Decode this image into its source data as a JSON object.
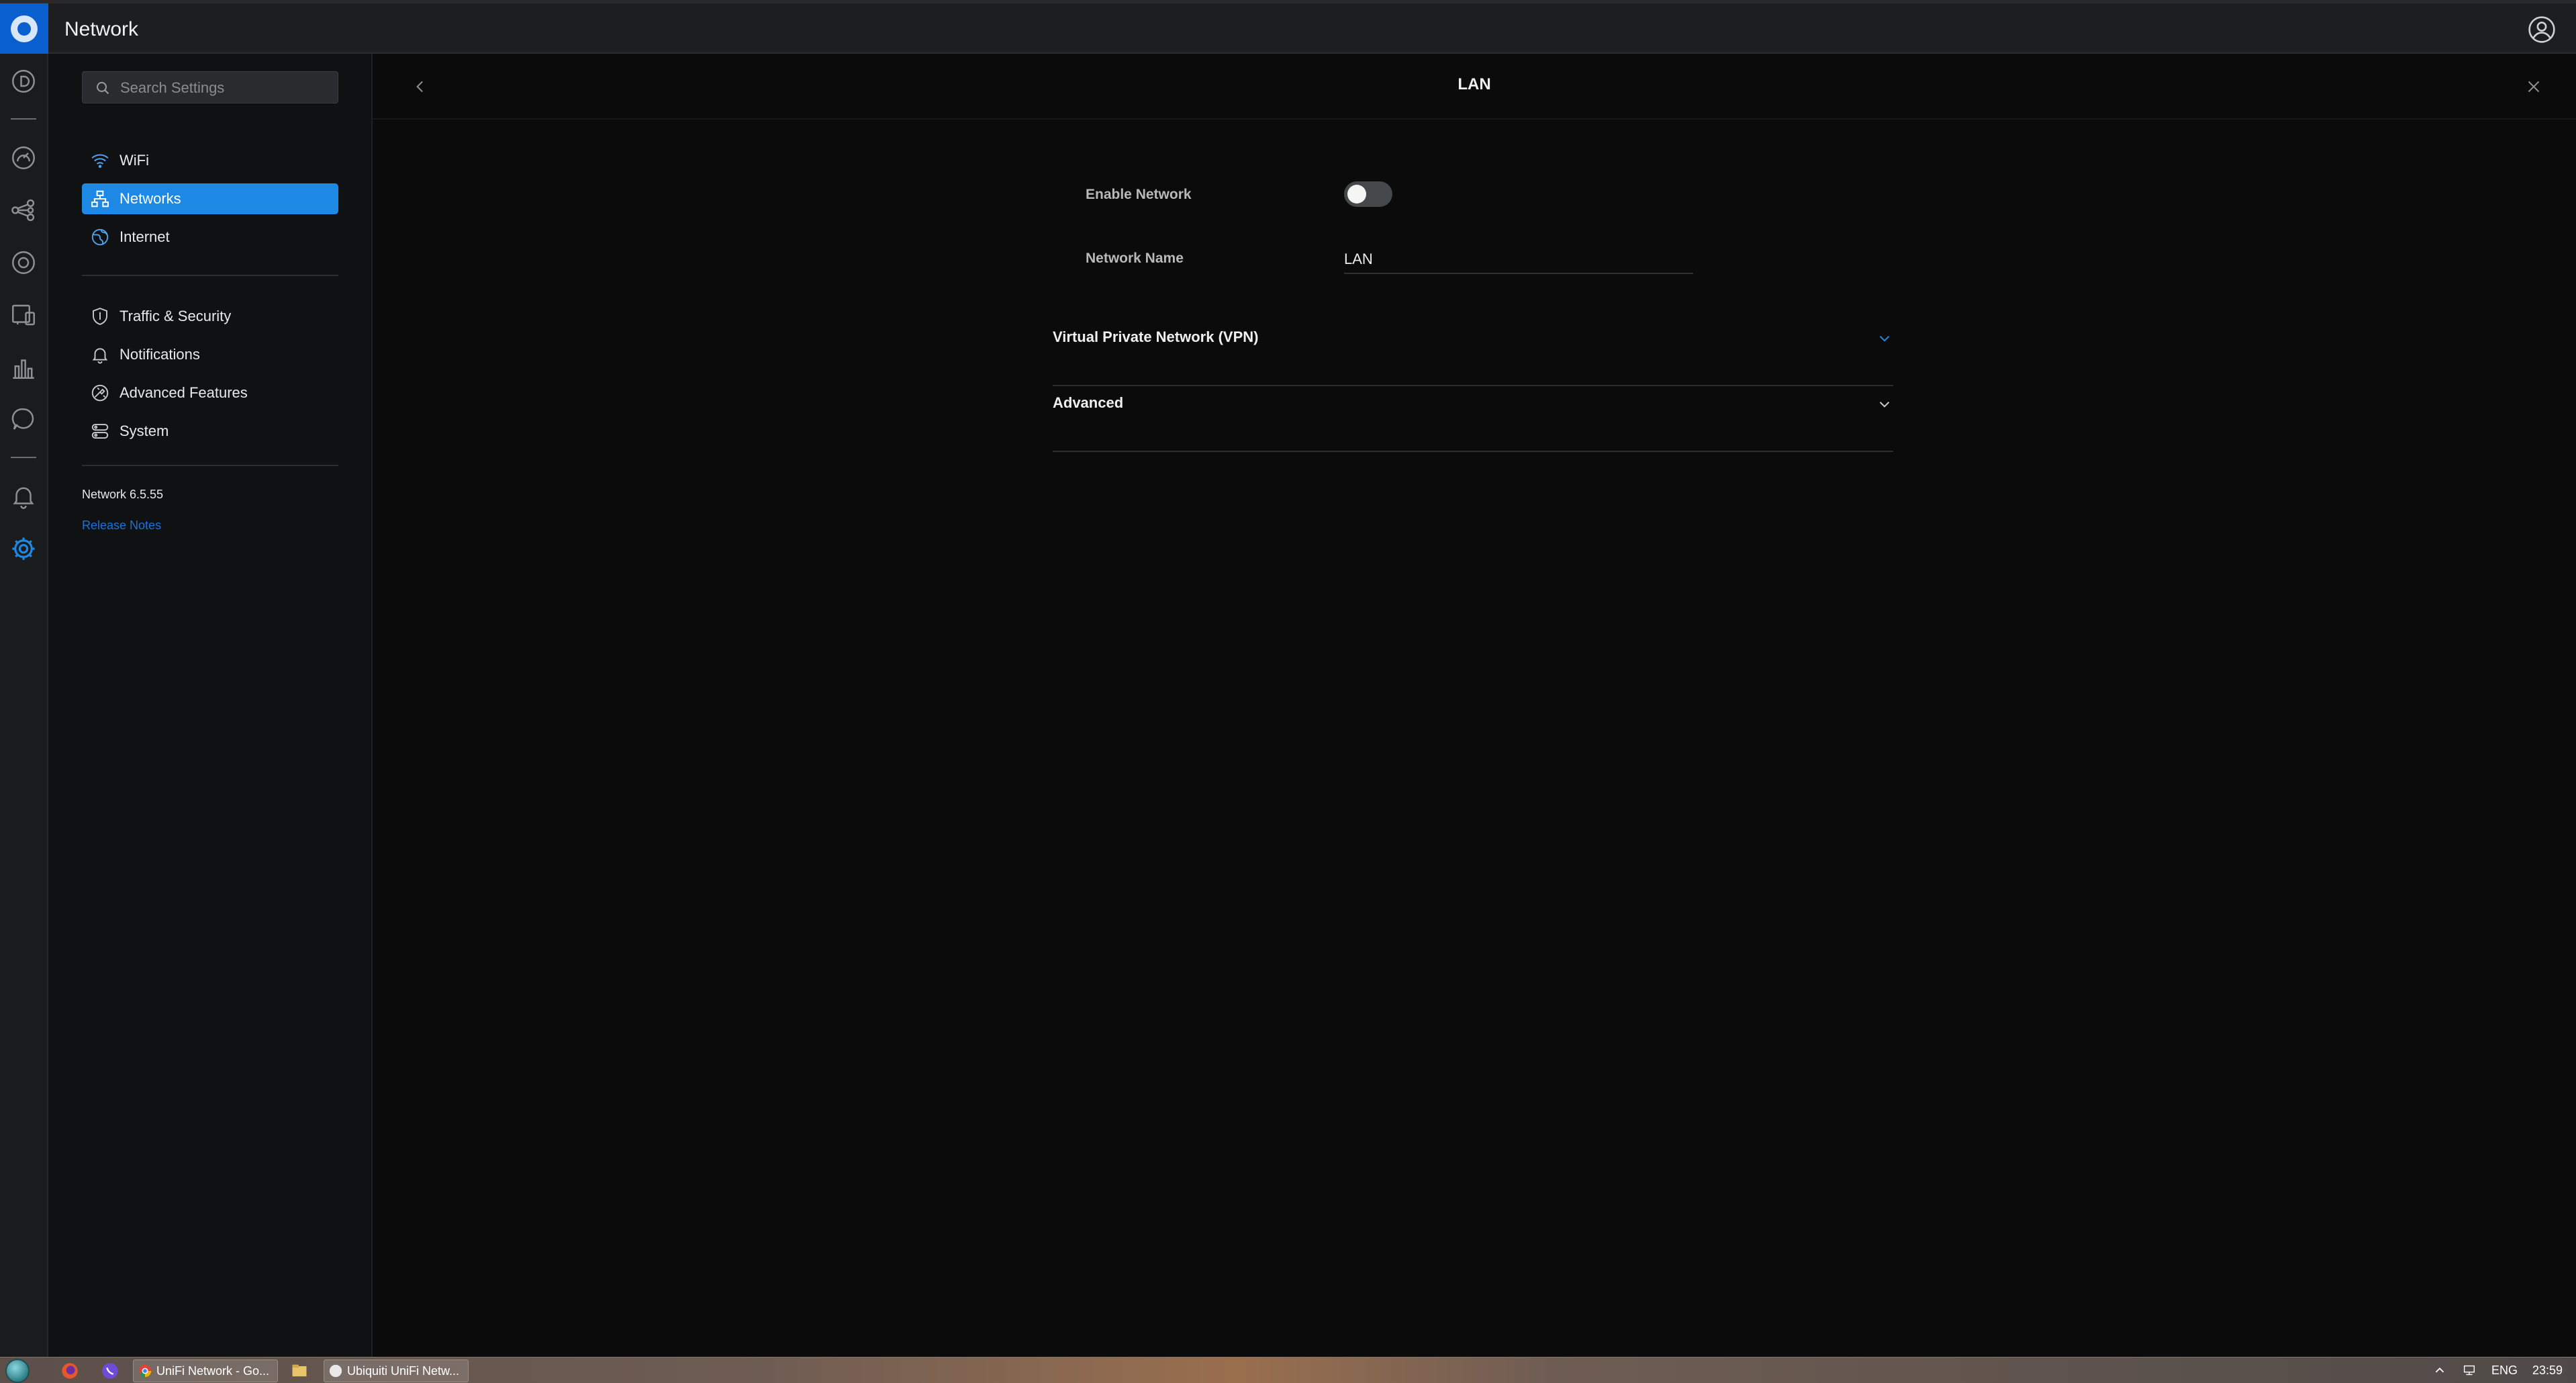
{
  "app": {
    "title": "Network"
  },
  "search": {
    "placeholder": "Search Settings",
    "value": ""
  },
  "sidebar": {
    "items": [
      {
        "label": "WiFi",
        "icon": "wifi-icon"
      },
      {
        "label": "Networks",
        "icon": "networks-icon",
        "active": true
      },
      {
        "label": "Internet",
        "icon": "globe-icon"
      },
      {
        "label": "Traffic & Security",
        "icon": "shield-icon"
      },
      {
        "label": "Notifications",
        "icon": "bell-icon"
      },
      {
        "label": "Advanced Features",
        "icon": "advanced-features-icon"
      },
      {
        "label": "System",
        "icon": "system-icon"
      }
    ],
    "version": "Network 6.5.55",
    "release_notes": "Release Notes"
  },
  "panel": {
    "title": "LAN",
    "enable_network_label": "Enable Network",
    "enable_network_on": false,
    "network_name_label": "Network Name",
    "network_name_value": "LAN",
    "sections": [
      {
        "label": "Virtual Private Network (VPN)",
        "expanded": false
      },
      {
        "label": "Advanced",
        "expanded": false
      }
    ]
  },
  "taskbar": {
    "windows": [
      {
        "label": "UniFi Network - Go...",
        "icon": "chrome-icon"
      },
      {
        "label": "Ubiquiti UniFi Netw...",
        "icon": "app-window-icon"
      }
    ],
    "language": "ENG",
    "clock": "23:59"
  },
  "colors": {
    "accent": "#1e88e5",
    "link": "#1a73d9",
    "brand": "#0a5fcf",
    "background": "#0b0b0b"
  }
}
